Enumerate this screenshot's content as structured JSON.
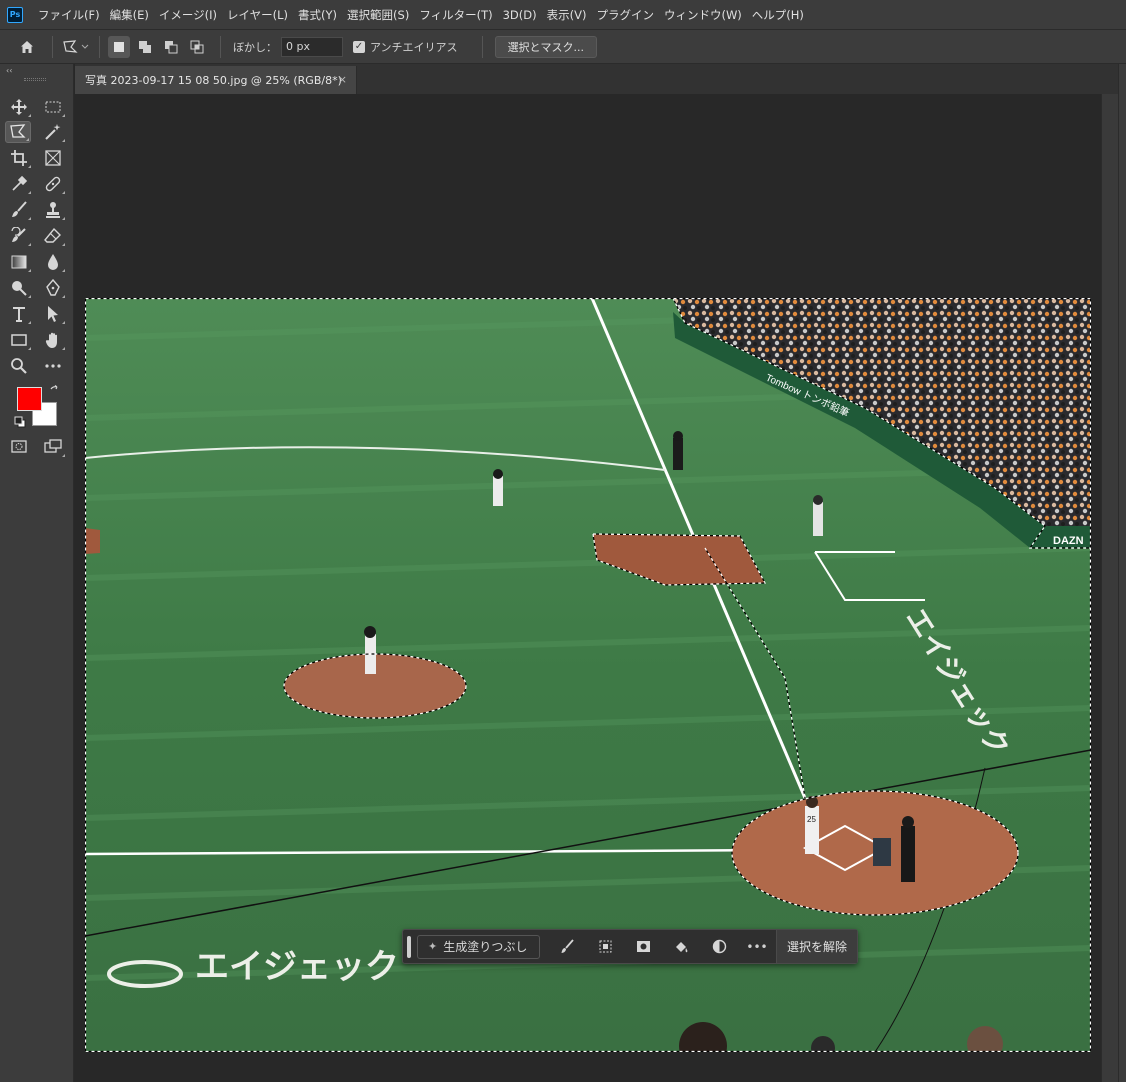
{
  "app": {
    "logo": "Ps"
  },
  "menu": [
    "ファイル(F)",
    "編集(E)",
    "イメージ(I)",
    "レイヤー(L)",
    "書式(Y)",
    "選択範囲(S)",
    "フィルター(T)",
    "3D(D)",
    "表示(V)",
    "プラグイン",
    "ウィンドウ(W)",
    "ヘルプ(H)"
  ],
  "options": {
    "feather_label": "ぼかし：",
    "feather_value": "0 px",
    "antialias_label": "アンチエイリアス",
    "antialias_checked": true,
    "mask_button": "選択とマスク..."
  },
  "toolbar": {
    "collapse": "‹‹",
    "foreground_color": "#ff0000",
    "background_color": "#ffffff",
    "tools": [
      "move-tool",
      "rectangular-marquee-tool",
      "polygonal-lasso-tool",
      "magic-wand-tool",
      "crop-tool",
      "frame-tool",
      "eyedropper-tool",
      "spot-healing-brush-tool",
      "brush-tool",
      "clone-stamp-tool",
      "history-brush-tool",
      "eraser-tool",
      "gradient-tool",
      "blur-tool",
      "dodge-tool",
      "pen-tool",
      "type-tool",
      "path-selection-tool",
      "rectangle-tool",
      "hand-tool",
      "zoom-tool",
      "more-tools",
      "quick-mask-mode",
      "screen-mode"
    ]
  },
  "document": {
    "tab_title": "写真 2023-09-17 15 08 50.jpg @ 25% (RGB/8*)",
    "close": "×"
  },
  "taskbar": {
    "generative_fill": "生成塗りつぶし",
    "deselect": "選択を解除",
    "more": "•••"
  },
  "scene": {
    "banner_sponsor_1": "Tombow トンボ鉛筆",
    "banner_sponsor_2": "DAZN",
    "field_text_bottom": "エイジェック",
    "field_text_right": "エイジェック",
    "batter_number": "25"
  },
  "colors": {
    "turf": "#3f7a45",
    "dirt": "#b0694a",
    "selection": "#ffffff",
    "accent": "#31a8ff"
  }
}
